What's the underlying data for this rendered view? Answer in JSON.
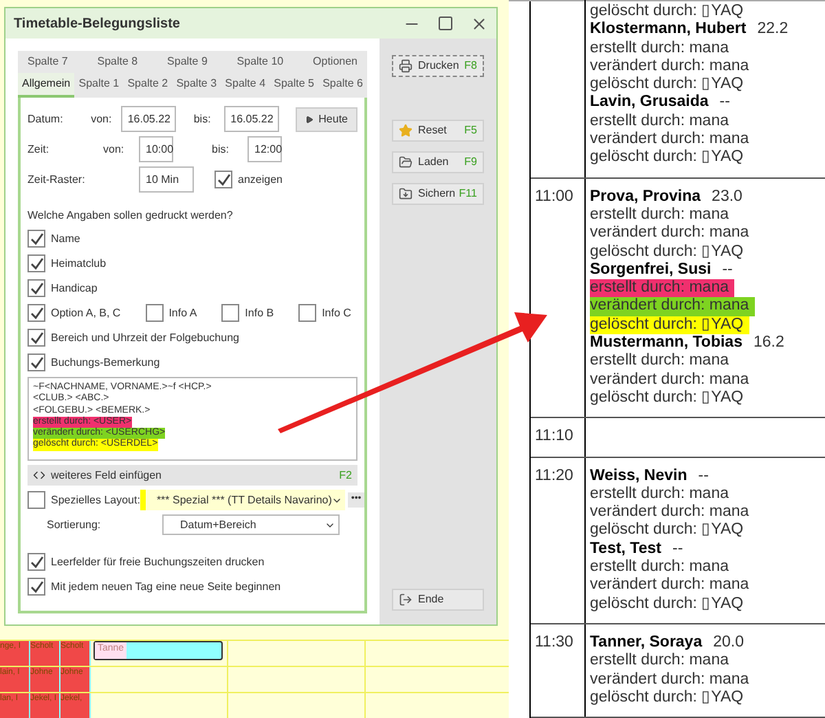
{
  "background": {
    "cells": [
      [
        "nge, I",
        "Scholt",
        "Scholt"
      ],
      [
        "lain, I",
        "Johne",
        "Johne"
      ],
      [
        "lan, I",
        "Jekel, I",
        "Jekel,"
      ]
    ],
    "booking": "Tanne"
  },
  "dialog": {
    "title": "Timetable-Belegungsliste",
    "tab_rows": [
      [
        {
          "label": "Spalte 7",
          "selected": false
        },
        {
          "label": "Spalte 8",
          "selected": false
        },
        {
          "label": "Spalte 9",
          "selected": false
        },
        {
          "label": "Spalte 10",
          "selected": false
        },
        {
          "label": "Optionen",
          "selected": false
        }
      ],
      [
        {
          "label": "Allgemein",
          "selected": true
        },
        {
          "label": "Spalte 1",
          "selected": false
        },
        {
          "label": "Spalte 2",
          "selected": false
        },
        {
          "label": "Spalte 3",
          "selected": false
        },
        {
          "label": "Spalte 4",
          "selected": false
        },
        {
          "label": "Spalte 5",
          "selected": false
        },
        {
          "label": "Spalte 6",
          "selected": false
        }
      ]
    ],
    "datum": {
      "label": "Datum:",
      "from_label": "von:",
      "from": "16.05.22",
      "to_label": "bis:",
      "to": "16.05.22",
      "button": "Heute"
    },
    "zeit": {
      "label": "Zeit:",
      "from_label": "von:",
      "from": "10:00",
      "to_label": "bis:",
      "to": "12:00"
    },
    "raster": {
      "label": "Zeit-Raster:",
      "value": "10 Min",
      "show": {
        "label": "anzeigen",
        "checked": true
      }
    },
    "question": "Welche Angaben sollen gedruckt werden?",
    "option_rows": [
      [
        {
          "label": "Name",
          "checked": true
        }
      ],
      [
        {
          "label": "Heimatclub",
          "checked": true
        }
      ],
      [
        {
          "label": "Handicap",
          "checked": true
        }
      ],
      [
        {
          "label": "Option A, B, C",
          "checked": true
        },
        {
          "label": "Info A",
          "checked": false
        },
        {
          "label": "Info B",
          "checked": false
        },
        {
          "label": "Info C",
          "checked": false
        }
      ],
      [
        {
          "label": "Bereich und Uhrzeit der Folgebuchung",
          "checked": true
        }
      ],
      [
        {
          "label": "Buchungs-Bemerkung",
          "checked": true
        }
      ]
    ],
    "template_lines": [
      {
        "text": "~F<NACHNAME, VORNAME.>~f <HCP.>"
      },
      {
        "text": "<CLUB.> <ABC.>"
      },
      {
        "text": "<FOLGEBU.> <BEMERK.>"
      },
      {
        "text": "erstellt durch: <USER>",
        "color": "#f0306e"
      },
      {
        "text": "verändert durch: <USERCHG>",
        "color": "#7ed321"
      },
      {
        "text": "gelöscht durch: <USERDEL>",
        "color": "#ffff00"
      }
    ],
    "insert_field": {
      "label": "weiteres Feld einfügen",
      "key": "F2"
    },
    "layout": {
      "label": "Spezielles Layout:",
      "checked": false,
      "value": "*** Spezial *** (TT Details Navarino)",
      "more": "•••"
    },
    "sort": {
      "label": "Sortierung:",
      "value": "Datum+Bereich"
    },
    "bottom_options": [
      {
        "label": "Leerfelder für freie Buchungszeiten drucken",
        "checked": true
      },
      {
        "label": "Mit jedem neuen Tag eine neue Seite beginnen",
        "checked": true
      }
    ],
    "buttons": [
      {
        "kind": "print",
        "label": "Drucken",
        "key": "F8"
      },
      {
        "kind": "reset",
        "label": "Reset",
        "key": "F5"
      },
      {
        "kind": "load",
        "label": "Laden",
        "key": "F9"
      },
      {
        "kind": "save",
        "label": "Sichern",
        "key": "F11"
      },
      {
        "kind": "exit",
        "label": "Ende"
      }
    ]
  },
  "report": {
    "rows": [
      {
        "time": "",
        "entries": [
          {
            "lines": [
              {
                "text": "gelöscht durch: ▯YAQ"
              }
            ]
          },
          {
            "name": "Klostermann, Hubert",
            "hcp": "22.2",
            "lines": [
              {
                "text": "erstellt durch: mana"
              },
              {
                "text": "verändert durch: mana"
              },
              {
                "text": "gelöscht durch: ▯YAQ"
              }
            ]
          },
          {
            "name": "Lavin, Grusaida",
            "hcp": "--",
            "lines": [
              {
                "text": "erstellt durch: mana"
              },
              {
                "text": "verändert durch: mana"
              },
              {
                "text": "gelöscht durch: ▯YAQ"
              }
            ]
          }
        ]
      },
      {
        "time": "11:00",
        "entries": [
          {
            "name": "Prova, Provina",
            "hcp": "23.0",
            "lines": [
              {
                "text": "erstellt durch: mana"
              },
              {
                "text": "verändert durch: mana"
              },
              {
                "text": "gelöscht durch: ▯YAQ"
              }
            ]
          },
          {
            "name": "Sorgenfrei, Susi",
            "hcp": "--",
            "lines": [
              {
                "text": "erstellt durch: mana",
                "color": "#f0306e"
              },
              {
                "text": "verändert durch: mana",
                "color": "#7ed321"
              },
              {
                "text": "gelöscht durch: ▯YAQ",
                "color": "#ffff00"
              }
            ]
          },
          {
            "name": "Mustermann, Tobias",
            "hcp": "16.2",
            "lines": [
              {
                "text": "erstellt durch: mana"
              },
              {
                "text": "verändert durch: mana"
              },
              {
                "text": "gelöscht durch: ▯YAQ"
              }
            ]
          }
        ]
      },
      {
        "time": "11:10",
        "entries": []
      },
      {
        "time": "11:20",
        "entries": [
          {
            "name": "Weiss, Nevin",
            "hcp": "--",
            "lines": [
              {
                "text": "erstellt durch: mana"
              },
              {
                "text": "verändert durch: mana"
              },
              {
                "text": "gelöscht durch: ▯YAQ"
              }
            ]
          },
          {
            "name": "Test, Test",
            "hcp": "--",
            "lines": [
              {
                "text": "erstellt durch: mana"
              },
              {
                "text": "verändert durch: mana"
              },
              {
                "text": "gelöscht durch: ▯YAQ"
              }
            ]
          }
        ]
      },
      {
        "time": "11:30",
        "entries": [
          {
            "name": "Tanner, Soraya",
            "hcp": "20.0",
            "lines": [
              {
                "text": "erstellt durch: mana"
              },
              {
                "text": "verändert durch: mana"
              },
              {
                "text": "gelöscht durch: ▯YAQ"
              }
            ]
          }
        ]
      }
    ]
  }
}
